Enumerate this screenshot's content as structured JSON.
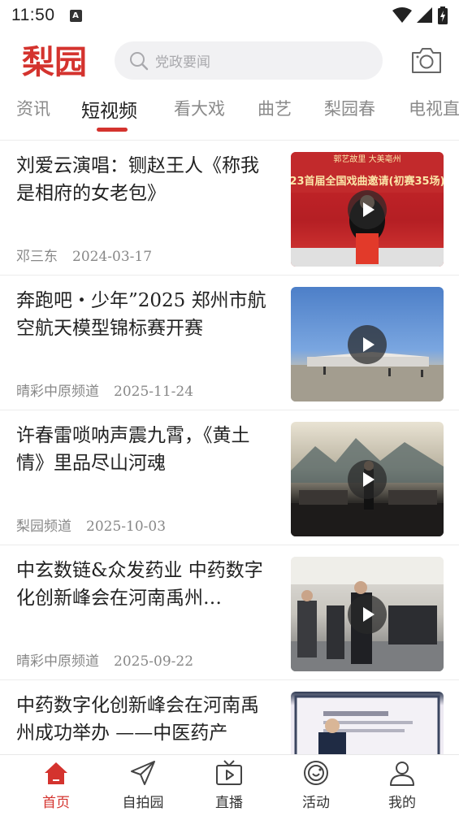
{
  "status_bar": {
    "time": "11:50",
    "a_badge": "A"
  },
  "header": {
    "logo_text": "梨园",
    "search_placeholder": "党政要闻",
    "brand_color": "#d4332e"
  },
  "tabs": [
    {
      "label": "资讯",
      "active": false
    },
    {
      "label": "短视频",
      "active": true
    },
    {
      "label": "看大戏",
      "active": false
    },
    {
      "label": "曲艺",
      "active": false
    },
    {
      "label": "梨园春",
      "active": false
    },
    {
      "label": "电视直",
      "active": false
    }
  ],
  "feed": [
    {
      "title": "刘爱云演唱：铡赵王人《称我是相府的女老包》",
      "source": "邓三东",
      "date": "2024-03-17",
      "thumb_text": "23首届全国戏曲邀请(初赛35场)"
    },
    {
      "title": "奔跑吧・少年”2025 郑州市航空航天模型锦标赛开赛",
      "source": "晴彩中原频道",
      "date": "2025-11-24",
      "thumb_text": ""
    },
    {
      "title": "许春雷唢呐声震九霄，《黄土情》里品尽山河魂",
      "source": "梨园频道",
      "date": "2025-10-03",
      "thumb_text": ""
    },
    {
      "title": "中玄数链&众发药业 中药数字化创新峰会在河南禹州…",
      "source": "晴彩中原频道",
      "date": "2025-09-22",
      "thumb_text": ""
    },
    {
      "title": "中药数字化创新峰会在河南禹州成功举办 ——中医药产",
      "source": "",
      "date": "",
      "thumb_text": ""
    }
  ],
  "bottom_nav": [
    {
      "label": "首页",
      "icon": "home-icon",
      "active": true
    },
    {
      "label": "自拍园",
      "icon": "send-icon",
      "active": false
    },
    {
      "label": "直播",
      "icon": "tv-play-icon",
      "active": false
    },
    {
      "label": "活动",
      "icon": "activity-icon",
      "active": false
    },
    {
      "label": "我的",
      "icon": "profile-icon",
      "active": false
    }
  ]
}
